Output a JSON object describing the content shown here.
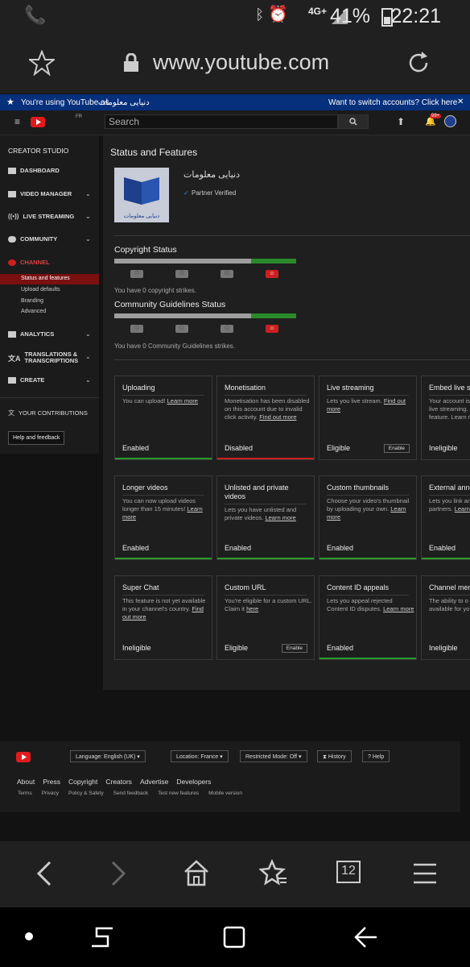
{
  "status_bar": {
    "time": "22:21",
    "battery": "41%",
    "network": "4G+"
  },
  "browser": {
    "url": "www.youtube.com"
  },
  "banner": {
    "prefix": "You're using YouTube as",
    "channel": "دنیایی معلومات",
    "switch": "Want to switch accounts? Click here"
  },
  "header": {
    "search_placeholder": "Search",
    "region": "FR",
    "notif_count": "99+"
  },
  "sidebar": {
    "title": "CREATOR STUDIO",
    "items": [
      {
        "label": "DASHBOARD"
      },
      {
        "label": "VIDEO MANAGER"
      },
      {
        "label": "LIVE STREAMING"
      },
      {
        "label": "COMMUNITY"
      },
      {
        "label": "CHANNEL"
      },
      {
        "label": "ANALYTICS"
      },
      {
        "label": "TRANSLATIONS &"
      },
      {
        "label": "TRANSCRIPTIONS"
      },
      {
        "label": "CREATE"
      },
      {
        "label": "YOUR CONTRIBUTIONS"
      }
    ],
    "subitems": [
      "Status and features",
      "Upload defaults",
      "Branding",
      "Advanced"
    ],
    "help": "Help and feedback"
  },
  "main": {
    "title": "Status and Features",
    "channel_name": "دنیایی معلومات",
    "thumb_text": "دنیایی معلومات",
    "partner": "Partner Verified",
    "copyright_title": "Copyright Status",
    "copyright_text": "You have 0 copyright strikes.",
    "community_title": "Community Guidelines Status",
    "community_text": "You have 0 Community Guidelines strikes."
  },
  "cards": [
    {
      "title": "Uploading",
      "desc": "You can upload!",
      "link": "Learn more",
      "status": "Enabled",
      "bar": "#2a9a2a"
    },
    {
      "title": "Monetisation",
      "desc": "Monetisation has been disabled on this account due to invalid click activity.",
      "link": "Find out more",
      "status": "Disabled",
      "bar": "#cc1f1f"
    },
    {
      "title": "Live streaming",
      "desc": "Lets you live stream.",
      "link": "Find out more",
      "status": "Eligible",
      "bar": "",
      "btn": "Enable"
    },
    {
      "title": "Embed live str",
      "desc": "Your account is eligible to embed live streaming. Streaming feature. Learn more info.",
      "link": "",
      "status": "Ineligible",
      "bar": ""
    },
    {
      "title": "Longer videos",
      "desc": "You can now upload videos longer than 15 minutes!",
      "link": "Learn more",
      "status": "Enabled",
      "bar": "#2a9a2a"
    },
    {
      "title": "Unlisted and private videos",
      "desc": "Lets you have unlisted and private videos.",
      "link": "Learn more",
      "status": "Enabled",
      "bar": "#2a9a2a"
    },
    {
      "title": "Custom thumbnails",
      "desc": "Choose your video's thumbnail by uploading your own.",
      "link": "Learn more",
      "status": "Enabled",
      "bar": "#2a9a2a"
    },
    {
      "title": "External anno",
      "desc": "Lets you link an external sites o partners.",
      "link": "Learn",
      "status": "Enabled",
      "bar": "#2a9a2a"
    },
    {
      "title": "Super Chat",
      "desc": "This feature is not yet available in your channel's country.",
      "link": "Find out more",
      "status": "Ineligible",
      "bar": ""
    },
    {
      "title": "Custom URL",
      "desc": "You're eligible for a custom URL. Claim it",
      "link": "here",
      "status": "Eligible",
      "bar": "",
      "btn": "Enable"
    },
    {
      "title": "Content ID appeals",
      "desc": "Lets you appeal rejected Content ID disputes.",
      "link": "Learn more",
      "status": "Enabled",
      "bar": "#2a9a2a"
    },
    {
      "title": "Channel mem",
      "desc": "The ability to o memberships i available for yo",
      "link": "Learn more",
      "status": "Ineligible",
      "bar": ""
    }
  ],
  "footer": {
    "language": "Language: English (UK)",
    "location": "Location: France",
    "restricted": "Restricted Mode: Off",
    "history": "History",
    "help": "Help",
    "links1": [
      "About",
      "Press",
      "Copyright",
      "Creators",
      "Advertise",
      "Developers"
    ],
    "links2": [
      "Terms",
      "Privacy",
      "Policy & Safety",
      "Send feedback",
      "Test new features",
      "Mobile version"
    ]
  },
  "browser_nav": {
    "tab_count": "12"
  }
}
